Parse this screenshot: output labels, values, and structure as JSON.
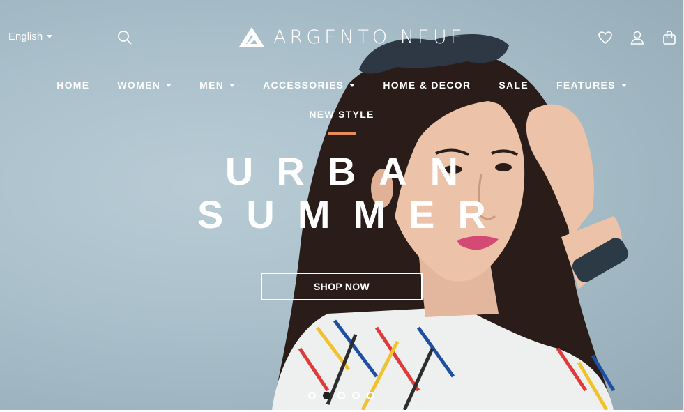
{
  "header": {
    "language": "English",
    "brand": "ARGENTO NEUE"
  },
  "nav": {
    "items": [
      {
        "label": "HOME",
        "dropdown": false
      },
      {
        "label": "WOMEN",
        "dropdown": true
      },
      {
        "label": "MEN",
        "dropdown": true
      },
      {
        "label": "ACCESSORIES",
        "dropdown": true
      },
      {
        "label": "HOME & DECOR",
        "dropdown": false
      },
      {
        "label": "SALE",
        "dropdown": false
      },
      {
        "label": "FEATURES",
        "dropdown": true
      }
    ],
    "second_row": "NEW STYLE"
  },
  "hero": {
    "line1": "URBAN",
    "line2": "SUMMER",
    "cta": "SHOP NOW",
    "slides": 5,
    "active_slide": 2
  },
  "colors": {
    "accent": "#e98c5d",
    "text": "#ffffff",
    "active_dot": "#222222"
  }
}
